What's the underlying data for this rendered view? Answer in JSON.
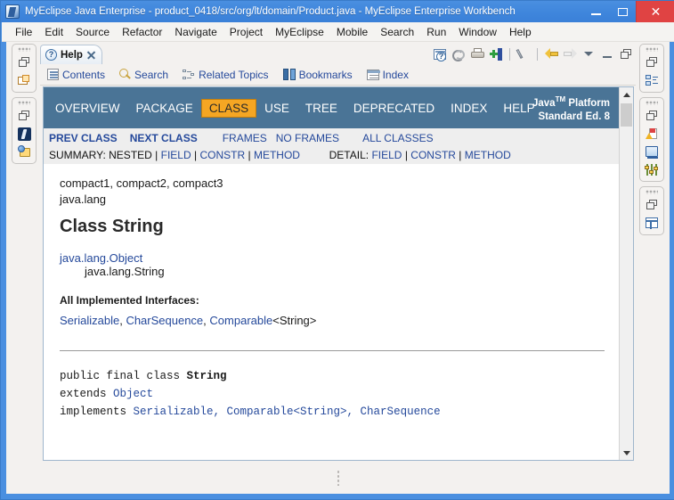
{
  "window": {
    "title": "MyEclipse Java Enterprise - product_0418/src/org/lt/domain/Product.java - MyEclipse Enterprise Workbench",
    "icon": "myeclipse-logo-icon",
    "minimize_label": "–",
    "maximize_label": "□",
    "close_label": "✕",
    "close_color": "#e04343",
    "titlebar_color": "#3f86dc"
  },
  "menubar": {
    "items": [
      {
        "label": "File"
      },
      {
        "label": "Edit"
      },
      {
        "label": "Source"
      },
      {
        "label": "Refactor"
      },
      {
        "label": "Navigate"
      },
      {
        "label": "Project"
      },
      {
        "label": "MyEclipse"
      },
      {
        "label": "Mobile"
      },
      {
        "label": "Search"
      },
      {
        "label": "Run"
      },
      {
        "label": "Window"
      },
      {
        "label": "Help"
      }
    ]
  },
  "left_fastview": {
    "groups": [
      {
        "icons": [
          "restore-icon",
          "package-explorer-icon"
        ]
      },
      {
        "icons": [
          "restore-icon",
          "myeclipse-perspective-icon",
          "java-perspective-icon"
        ]
      }
    ]
  },
  "right_fastview": {
    "groups": [
      {
        "icons": [
          "restore-icon",
          "outline-icon"
        ]
      },
      {
        "icons": [
          "restore-icon",
          "problems-icon",
          "console-icon",
          "preferences-icon"
        ]
      },
      {
        "icons": [
          "restore-icon",
          "table-view-icon"
        ]
      }
    ]
  },
  "help_view": {
    "tab": {
      "label": "Help",
      "icon": "help-question-icon",
      "close_icon": "close-icon"
    },
    "toolbar": [
      {
        "name": "show-in-toc-icon",
        "tooltip": "Show in Table of Contents"
      },
      {
        "name": "synchronize-icon",
        "tooltip": "Synchronize"
      },
      {
        "name": "print-icon",
        "tooltip": "Print Page"
      },
      {
        "name": "add-bookmark-icon",
        "tooltip": "Bookmark Document"
      },
      {
        "name": "highlight-pen-icon",
        "tooltip": "Highlight"
      },
      {
        "name": "back-arrow-icon",
        "tooltip": "Back"
      },
      {
        "name": "forward-arrow-icon",
        "tooltip": "Forward"
      },
      {
        "name": "view-menu-icon",
        "tooltip": "View Menu"
      },
      {
        "name": "minimize-icon",
        "tooltip": "Minimize"
      },
      {
        "name": "maximize-icon",
        "tooltip": "Maximize"
      }
    ],
    "nav_links": [
      {
        "label": "Contents",
        "icon": "contents-icon"
      },
      {
        "label": "Search",
        "icon": "search-icon"
      },
      {
        "label": "Related Topics",
        "icon": "related-topics-icon"
      },
      {
        "label": "Bookmarks",
        "icon": "bookmarks-icon"
      },
      {
        "label": "Index",
        "icon": "index-icon"
      }
    ]
  },
  "javadoc": {
    "topnav": {
      "background": "#4a7496",
      "active_background": "#f5a623",
      "items": [
        {
          "label": "OVERVIEW",
          "active": false
        },
        {
          "label": "PACKAGE",
          "active": false
        },
        {
          "label": "CLASS",
          "active": true
        },
        {
          "label": "USE",
          "active": false
        },
        {
          "label": "TREE",
          "active": false
        },
        {
          "label": "DEPRECATED",
          "active": false
        },
        {
          "label": "INDEX",
          "active": false
        },
        {
          "label": "HELP",
          "active": false
        }
      ],
      "brand_line1": "Java",
      "brand_tm": "TM",
      "brand_line1_rest": " Platform",
      "brand_line2": "Standard Ed. 8"
    },
    "subnav": {
      "prev_class": "PREV CLASS",
      "next_class": "NEXT CLASS",
      "frames": "FRAMES",
      "no_frames": "NO FRAMES",
      "all_classes": "ALL CLASSES",
      "summary_label": "SUMMARY:",
      "summary_items": [
        "NESTED",
        "FIELD",
        "CONSTR",
        "METHOD"
      ],
      "detail_label": "DETAIL:",
      "detail_items": [
        "FIELD",
        "CONSTR",
        "METHOD"
      ],
      "separator": "|"
    },
    "content": {
      "profiles": "compact1, compact2, compact3",
      "package": "java.lang",
      "title": "Class String",
      "inheritance_parent": "java.lang.Object",
      "inheritance_child": "java.lang.String",
      "implemented_heading": "All Implemented Interfaces:",
      "implemented": [
        {
          "text": "Serializable",
          "link": true
        },
        {
          "text": ", ",
          "link": false
        },
        {
          "text": "CharSequence",
          "link": true
        },
        {
          "text": ", ",
          "link": false
        },
        {
          "text": "Comparable",
          "link": true
        },
        {
          "text": "<String>",
          "link": false
        }
      ],
      "declaration": {
        "line1_pre": "public final class ",
        "line1_name": "String",
        "line2_pre": "extends ",
        "line2_link": "Object",
        "line3_pre": "implements ",
        "line3_links": "Serializable, Comparable<String>, CharSequence"
      }
    },
    "scrollbar": {
      "up_arrow": "scroll-up-icon",
      "down_arrow": "scroll-down-icon"
    }
  }
}
